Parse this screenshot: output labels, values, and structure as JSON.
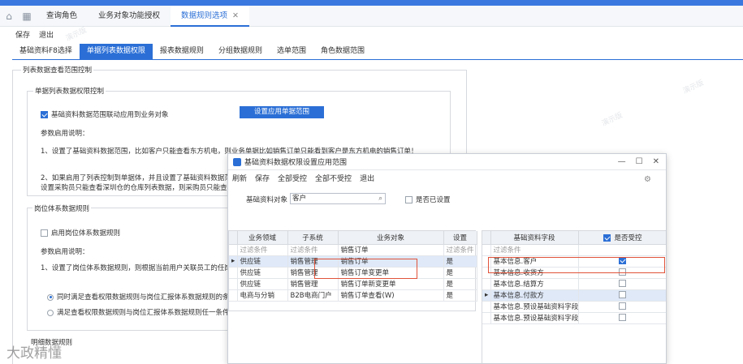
{
  "tabs": [
    "查询角色",
    "业务对象功能授权",
    "数据规则选项"
  ],
  "toolbar": {
    "save": "保存",
    "exit": "退出"
  },
  "subtabs": [
    "基础资料F8选择",
    "单据列表数据权限",
    "报表数据规则",
    "分组数据规则",
    "选单范围",
    "角色数据范围"
  ],
  "section1": {
    "title": "列表数据查看范围控制",
    "sub": "单据列表数据权限控制",
    "check_label": "基础资料数据范围联动应用到业务对象",
    "set_button": "设置应用单据范围",
    "desc_title": "参数启用说明：",
    "line1": "1、设置了基础资料数据范围，比如客户只能查看东方机电，则业务单据比如销售订单只能看到客户是东方机电的销售订单！",
    "line2a": "2、如果启用了列表控制到单据体，并且设置了基础资料数据范",
    "line2b": "设置采购员只能查看深圳仓的仓库列表数据，则采购员只能查看"
  },
  "section2": {
    "title": "岗位体系数据规则",
    "check_label": "启用岗位体系数据规则",
    "desc_title": "参数启用说明：",
    "line1": "1、设置了岗位体系数据规则，则根据当前用户关联员工的任岗",
    "radio1": "同时满足查看权限数据规则与岗位汇报体系数据规则的条",
    "radio2": "满足查看权限数据规则与岗位汇报体系数据规则任一条件"
  },
  "section3": {
    "title": "明细数据规则"
  },
  "watermark": "演示版",
  "bottom_watermark": "大政精懂",
  "dialog": {
    "title": "基础资料数据权限设置应用范围",
    "toolbar": [
      "刷新",
      "保存",
      "全部受控",
      "全部不受控",
      "退出"
    ],
    "object_label": "基础资料对象",
    "object_value": "客户",
    "is_set_label": "是否已设置",
    "left_grid": {
      "headers": [
        "业务领域",
        "子系统",
        "业务对象",
        "设置"
      ],
      "filter": [
        "过滤条件",
        "过滤条件",
        "销售订单",
        "过滤条件"
      ],
      "rows": [
        [
          "供应链",
          "销售管理",
          "销售订单",
          "是"
        ],
        [
          "供应链",
          "销售管理",
          "销售订单变更单",
          "是"
        ],
        [
          "供应链",
          "销售管理",
          "销售订单新变更单",
          "是"
        ],
        [
          "电商与分销",
          "B2B电商门户",
          "销售订单查看(W)",
          "是"
        ]
      ]
    },
    "right_grid": {
      "headers": [
        "基础资料字段",
        "是否受控"
      ],
      "filter": "过滤条件",
      "rows": [
        {
          "field": "基本信息.客户",
          "checked": true
        },
        {
          "field": "基本信息.收货方",
          "checked": false
        },
        {
          "field": "基本信息.结算方",
          "checked": false
        },
        {
          "field": "基本信息.付款方",
          "checked": false
        },
        {
          "field": "基本信息.预设基础资料字段",
          "checked": false
        },
        {
          "field": "基本信息.预设基础资料字段",
          "checked": false
        }
      ]
    }
  }
}
